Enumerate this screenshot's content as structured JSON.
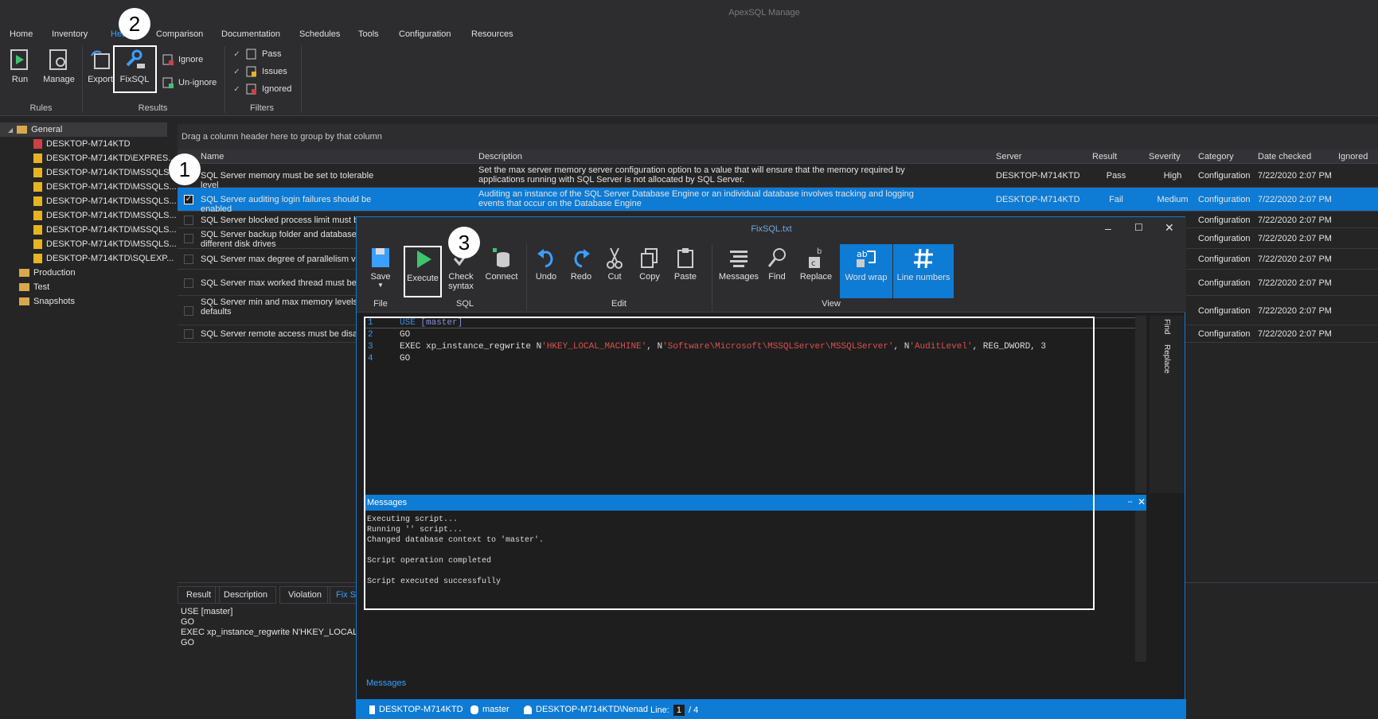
{
  "app": {
    "title": "ApexSQL Manage"
  },
  "menu": [
    "Home",
    "Inventory",
    "Health",
    "Comparison",
    "Documentation",
    "Schedules",
    "Tools",
    "Configuration",
    "Resources"
  ],
  "ribbon": {
    "run": "Run",
    "manage": "Manage",
    "export": "Export",
    "fixsql": "FixSQL",
    "ignore": "Ignore",
    "unignore": "Un-ignore",
    "pass": "Pass",
    "issues": "Issues",
    "ignored": "Ignored",
    "group_rules": "Rules",
    "group_results": "Results",
    "group_filters": "Filters"
  },
  "tree": {
    "general": "General",
    "servers": [
      "DESKTOP-M714KTD",
      "DESKTOP-M714KTD\\EXPRES...",
      "DESKTOP-M714KTD\\MSSQLS...",
      "DESKTOP-M714KTD\\MSSQLS...",
      "DESKTOP-M714KTD\\MSSQLS...",
      "DESKTOP-M714KTD\\MSSQLS...",
      "DESKTOP-M714KTD\\MSSQLS...",
      "DESKTOP-M714KTD\\MSSQLS...",
      "DESKTOP-M714KTD\\SQLEXP..."
    ],
    "production": "Production",
    "test": "Test",
    "snapshots": "Snapshots"
  },
  "grid": {
    "group_hint": "Drag a column header here to group by that column",
    "columns": [
      "Name",
      "Description",
      "Server",
      "Result",
      "Severity",
      "Category",
      "Date checked",
      "Ignored"
    ],
    "rows": [
      {
        "name": "SQL Server memory must be set to tolerable level",
        "desc": "Set the max server memory server configuration option to a value that will ensure that the memory required by applications running with SQL Server is not allocated by SQL Server.",
        "server": "DESKTOP-M714KTD",
        "result": "Pass",
        "severity": "High",
        "category": "Configuration",
        "date": "7/22/2020 2:07 PM"
      },
      {
        "name": "SQL Server auditing login failures should be enabled",
        "desc": "Auditing an instance of the SQL Server Database Engine or an individual database involves tracking and logging events that occur on the Database Engine",
        "server": "DESKTOP-M714KTD",
        "result": "Fail",
        "severity": "Medium",
        "category": "Configuration",
        "date": "7/22/2020 2:07 PM"
      },
      {
        "name": "SQL Server blocked process limit must be",
        "category": "Configuration",
        "date": "7/22/2020 2:07 PM"
      },
      {
        "name": "SQL Server backup folder and database",
        "name2": "different disk drives",
        "category": "Configuration",
        "date": "7/22/2020 2:07 PM"
      },
      {
        "name": "SQL Server max degree of parallelism va",
        "category": "Configuration",
        "date": "7/22/2020 2:07 PM"
      },
      {
        "name": "SQL Server max worked thread must be",
        "category": "Configuration",
        "date": "7/22/2020 2:07 PM"
      },
      {
        "name": "SQL Server min and max memory levels n",
        "name2": "defaults",
        "category": "Configuration",
        "date": "7/22/2020 2:07 PM"
      },
      {
        "name": "SQL Server remote access must be disab",
        "category": "Configuration",
        "date": "7/22/2020 2:07 PM"
      }
    ]
  },
  "bottom": {
    "tabs": [
      "Result",
      "Description",
      "Violation",
      "Fix S"
    ],
    "lines": [
      "USE [master]",
      "GO",
      "EXEC xp_instance_regwrite N'HKEY_LOCAL_M",
      "GO"
    ]
  },
  "fixsql": {
    "title": "FixSQL.txt",
    "toolbar": {
      "save": "Save",
      "execute": "Execute",
      "check": "Check",
      "syntax": "syntax",
      "connect": "Connect",
      "undo": "Undo",
      "redo": "Redo",
      "cut": "Cut",
      "copy": "Copy",
      "paste": "Paste",
      "messages": "Messages",
      "find": "Find",
      "replace": "Replace",
      "wordwrap": "Word wrap",
      "linenumbers": "Line numbers"
    },
    "groups": {
      "file": "File",
      "sql": "SQL",
      "edit": "Edit",
      "view": "View"
    },
    "code": {
      "l1a": "USE ",
      "l1b": "[master]",
      "l2": "GO",
      "l3a": "EXEC xp_instance_regwrite N",
      "l3b": "'HKEY_LOCAL_MACHINE'",
      "l3c": ", N",
      "l3d": "'Software\\Microsoft\\MSSQLServer\\MSSQLServer'",
      "l3e": ", N",
      "l3f": "'AuditLevel'",
      "l3g": ", REG_DWORD, 3",
      "l4": "GO"
    },
    "side": {
      "find": "Find",
      "replace": "Replace"
    },
    "messages_title": "Messages",
    "messages": [
      "Executing script...",
      "Running '' script...",
      "Changed database context to 'master'.",
      "",
      "Script operation completed",
      "",
      "Script executed successfully"
    ],
    "bottom_tab": "Messages",
    "status": {
      "server": "DESKTOP-M714KTD",
      "db": "master",
      "user": "DESKTOP-M714KTD\\Nenad",
      "line_label": "Line:",
      "line": "1",
      "total": "/ 4"
    }
  },
  "callouts": [
    "1",
    "2",
    "3"
  ]
}
